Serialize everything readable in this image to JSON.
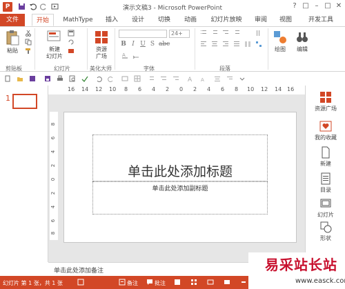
{
  "app": {
    "title": "演示文稿3 - Microsoft PowerPoint",
    "logo_letter": "P",
    "win_buttons": [
      "?",
      "□",
      "–",
      "□",
      "✕"
    ]
  },
  "tabs": [
    {
      "label": "文件",
      "kind": "file"
    },
    {
      "label": "开始",
      "kind": "active"
    },
    {
      "label": "MathType",
      "kind": "normal"
    },
    {
      "label": "插入",
      "kind": "normal"
    },
    {
      "label": "设计",
      "kind": "normal"
    },
    {
      "label": "切换",
      "kind": "normal"
    },
    {
      "label": "动画",
      "kind": "normal"
    },
    {
      "label": "幻灯片放映",
      "kind": "normal"
    },
    {
      "label": "审阅",
      "kind": "normal"
    },
    {
      "label": "视图",
      "kind": "normal"
    },
    {
      "label": "开发工具",
      "kind": "normal"
    }
  ],
  "ribbon": {
    "paste_label": "粘贴",
    "clipboard_group": "剪贴板",
    "new_slide_label_1": "新建",
    "new_slide_label_2": "幻灯片",
    "slides_group": "幻灯片",
    "resource_label_1": "资源",
    "resource_label_2": "广场",
    "beautify_group": "美化大师",
    "font_size": "24+",
    "font_group": "字体",
    "paragraph_group": "段落",
    "draw_label": "绘图",
    "edit_label": "编辑",
    "format_buttons": [
      "B",
      "I",
      "U",
      "S",
      "abc"
    ]
  },
  "ruler": {
    "h_ticks": [
      "16",
      "14",
      "12",
      "10",
      "8",
      "6",
      "4",
      "2",
      "0",
      "2",
      "4",
      "6",
      "8",
      "10",
      "12",
      "14",
      "16"
    ],
    "v_ticks": [
      "8",
      "6",
      "4",
      "2",
      "0",
      "2",
      "4",
      "6",
      "8"
    ]
  },
  "thumbs": {
    "number": "1"
  },
  "slide": {
    "title_placeholder": "单击此处添加标题",
    "subtitle_placeholder": "单击此处添加副标题"
  },
  "notes": {
    "placeholder": "单击此处添加备注"
  },
  "taskpane": [
    {
      "label": "资源广场",
      "icon": "grid-icon"
    },
    {
      "label": "我的收藏",
      "icon": "heart-icon"
    },
    {
      "label": "新建",
      "icon": "document-icon"
    },
    {
      "label": "目录",
      "icon": "list-icon"
    },
    {
      "label": "幻灯片",
      "icon": "slides-icon"
    },
    {
      "label": "形状",
      "icon": "shape-icon"
    }
  ],
  "status": {
    "slide_info": "幻灯片 第 1 张，共 1 张",
    "notes_btn": "备注",
    "comments_btn": "批注"
  },
  "watermark": {
    "main": "易采站长站",
    "sub": "www.easck.com"
  },
  "colors": {
    "accent": "#d24726",
    "watermark_red": "#c8102e"
  }
}
